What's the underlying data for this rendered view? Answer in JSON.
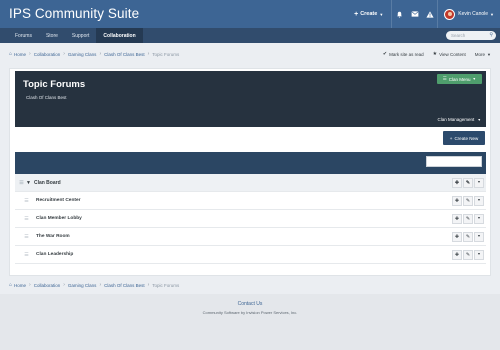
{
  "header": {
    "site_title": "IPS Community Suite",
    "create_label": "Create",
    "user_name": "Kevin Canole"
  },
  "nav": {
    "tabs": [
      {
        "label": "Forums"
      },
      {
        "label": "Store"
      },
      {
        "label": "Support"
      },
      {
        "label": "Collaboration"
      }
    ],
    "search_placeholder": "Search"
  },
  "breadcrumb": {
    "items": [
      "Home",
      "Collaboration",
      "Gaming Clans",
      "Clash Of Clans Best",
      "Topic Forums"
    ]
  },
  "page_actions": {
    "mark_read": "Mark site as read",
    "view_content": "View Content",
    "more": "More"
  },
  "clan": {
    "title": "Topic Forums",
    "subtitle": "Clash Of Clans Best",
    "menu_label": "Clan Menu",
    "management_label": "Clan Management"
  },
  "create_new_label": "Create New",
  "forums": {
    "category": "Clan Board",
    "children": [
      {
        "label": "Recruitment Center"
      },
      {
        "label": "Clan Member Lobby"
      },
      {
        "label": "The War Room"
      },
      {
        "label": "Clan Leadership"
      }
    ]
  },
  "footer": {
    "contact": "Contact Us",
    "copyright": "Community Software by Invision Power Services, Inc."
  },
  "colors": {
    "header": "#3d6594",
    "navbar": "#314c6d",
    "clan_header": "#26323f",
    "clan_menu_button": "#4f9e6d",
    "table_head": "#2b4663"
  }
}
